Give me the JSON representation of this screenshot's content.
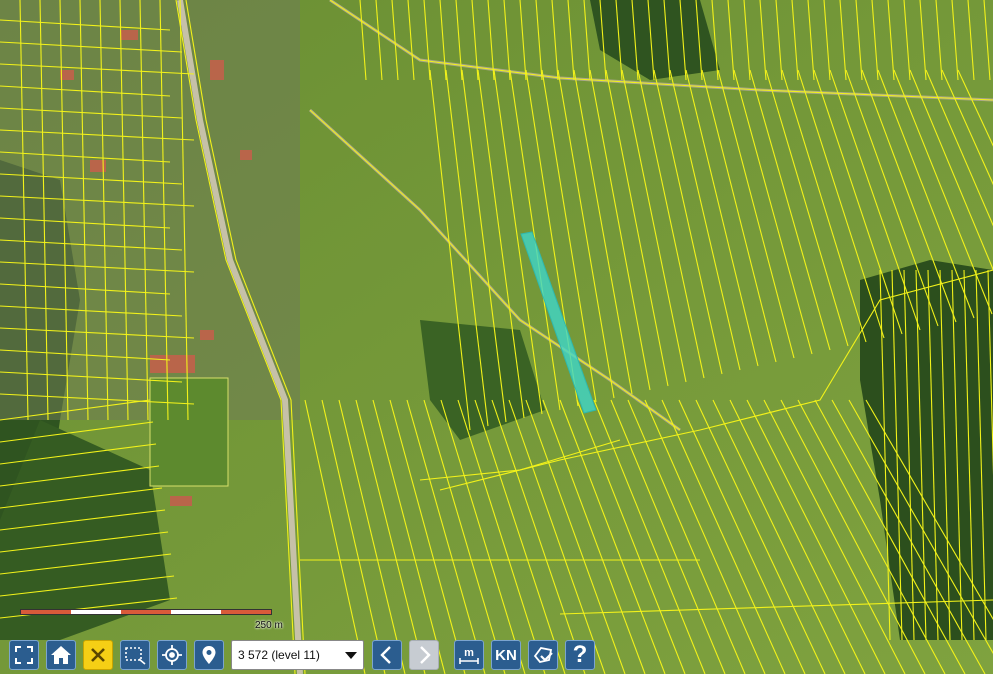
{
  "map": {
    "imagery": "orthophoto-with-parcel-boundaries",
    "parcel_line_color": "#f2f21a",
    "highlight_color": "#3fd6c9",
    "scale": {
      "label": "250 m"
    }
  },
  "toolbar": {
    "buttons": [
      {
        "name": "fullscreen-button",
        "icon": "fullscreen-icon"
      },
      {
        "name": "home-button",
        "icon": "home-icon"
      },
      {
        "name": "close-button",
        "icon": "close-icon",
        "active": true
      },
      {
        "name": "select-area-button",
        "icon": "select-area-icon"
      },
      {
        "name": "locate-button",
        "icon": "crosshair-icon"
      },
      {
        "name": "marker-button",
        "icon": "map-pin-icon"
      },
      {
        "name": "back-button",
        "icon": "chevron-left-icon"
      },
      {
        "name": "forward-button",
        "icon": "chevron-right-icon",
        "disabled": true
      },
      {
        "name": "measure-button",
        "icon": "measure-icon",
        "label": "m"
      },
      {
        "name": "cadastre-button",
        "label": "KN"
      },
      {
        "name": "parcel-info-button",
        "icon": "parcel-icon"
      },
      {
        "name": "help-button",
        "label": "?"
      }
    ],
    "scale_select": {
      "value": "3 572 (level 11)"
    }
  }
}
